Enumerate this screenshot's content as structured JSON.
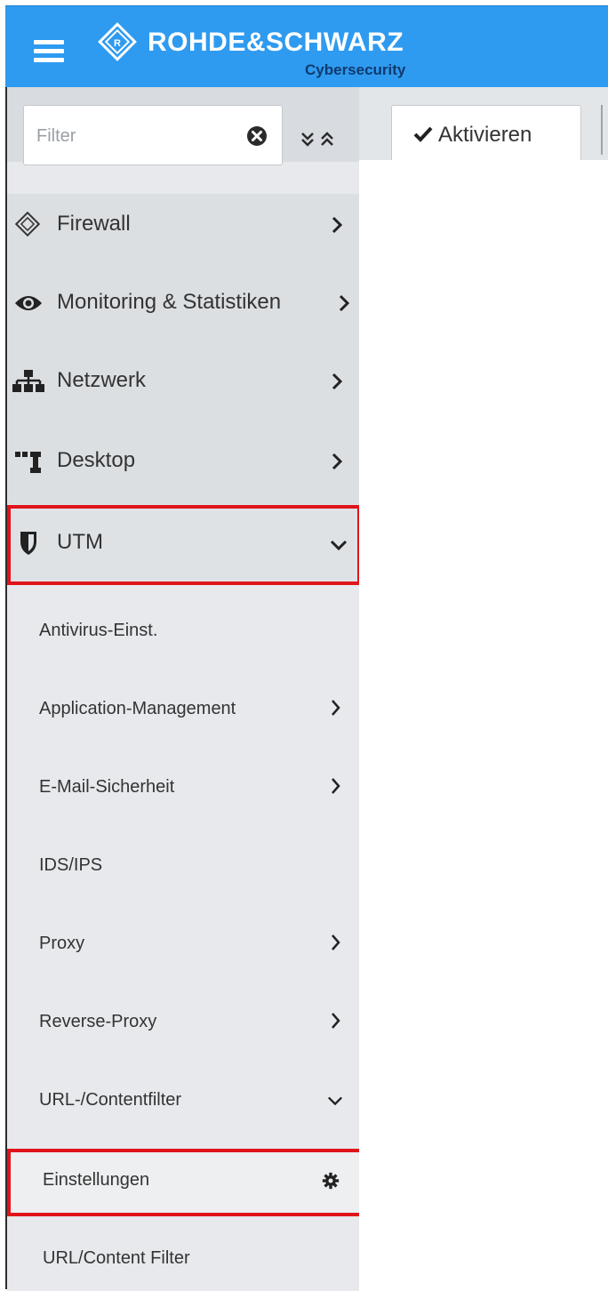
{
  "header": {
    "brand": "ROHDE&SCHWARZ",
    "sub_brand": "Cybersecurity",
    "color": "#2e9bf0",
    "menu_icon": "hamburger-icon",
    "logo_icon": "rs-logo-icon"
  },
  "filter": {
    "placeholder": "Filter",
    "value": "",
    "clear_icon": "times-circle-icon",
    "collapse_icon": "expand-collapse-icon"
  },
  "toolbar": {
    "activate_label": "Aktivieren",
    "activate_icon": "check-icon"
  },
  "nav": {
    "items": [
      {
        "label": "Firewall",
        "icon": "rs-diamond-icon",
        "chevron": "right"
      },
      {
        "label": "Monitoring & Statistiken",
        "icon": "eye-icon",
        "chevron": "right"
      },
      {
        "label": "Netzwerk",
        "icon": "sitemap-icon",
        "chevron": "right"
      },
      {
        "label": "Desktop",
        "icon": "desktop-tree-icon",
        "chevron": "right"
      },
      {
        "label": "UTM",
        "icon": "shield-icon",
        "chevron": "down",
        "expanded": true
      }
    ],
    "utm_children": [
      {
        "label": "Antivirus-Einst.",
        "chevron": "none"
      },
      {
        "label": "Application-Management",
        "chevron": "right"
      },
      {
        "label": "E-Mail-Sicherheit",
        "chevron": "right"
      },
      {
        "label": "IDS/IPS",
        "chevron": "none"
      },
      {
        "label": "Proxy",
        "chevron": "right"
      },
      {
        "label": "Reverse-Proxy",
        "chevron": "right"
      },
      {
        "label": "URL-/Contentfilter",
        "chevron": "down",
        "expanded": true
      }
    ],
    "urlfilter_children": [
      {
        "label": "Einstellungen",
        "icon": "gear-icon",
        "highlighted": true
      },
      {
        "label": "URL/Content Filter"
      }
    ]
  },
  "highlight_color": "#e0141b"
}
